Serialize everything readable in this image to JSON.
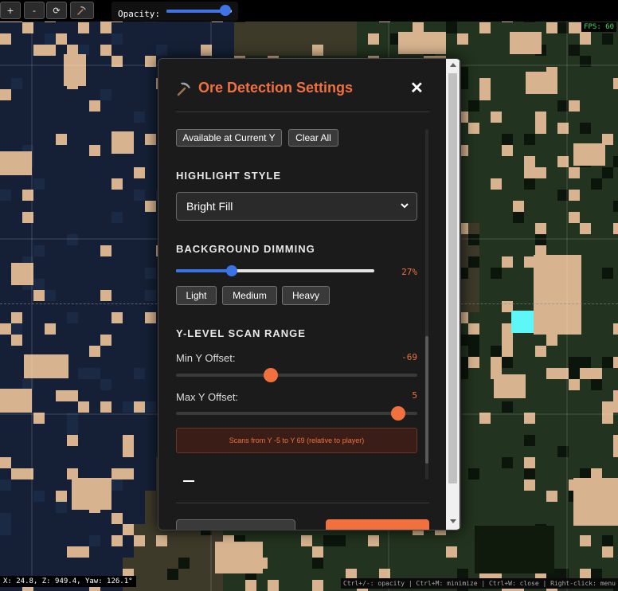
{
  "toolbar": {
    "buttons": [
      {
        "name": "zoom-in-button",
        "label": "+"
      },
      {
        "name": "zoom-out-button",
        "label": "-"
      },
      {
        "name": "refresh-button",
        "label": "⟳"
      }
    ],
    "pickaxe_icon": "pickaxe-icon",
    "opacity_label": "Opacity:",
    "opacity_value": 0.9
  },
  "fps": "FPS: 60",
  "coords": "X: 24.8, Z: 949.4, Yaw: 126.1°",
  "hints": "Ctrl+/-: opacity | Ctrl+M: minimize | Ctrl+W: close | Right-click: menu",
  "modal": {
    "title": "Ore Detection Settings",
    "title_icon": "pickaxe-icon",
    "close": "✕",
    "available_btn": "Available at Current Y",
    "clear_btn": "Clear All",
    "highlight": {
      "heading": "HIGHLIGHT STYLE",
      "selected": "Bright Fill"
    },
    "dimming": {
      "heading": "BACKGROUND DIMMING",
      "value_text": "27%",
      "value": 27,
      "presets": [
        "Light",
        "Medium",
        "Heavy"
      ]
    },
    "scan": {
      "heading": "Y-LEVEL SCAN RANGE",
      "min_label": "Min Y Offset:",
      "min_value": -69,
      "min_text": "-69",
      "max_label": "Max Y Offset:",
      "max_value": 5,
      "max_text": "5",
      "info": "Scans from Y -5  to Y 69  (relative to player)"
    }
  },
  "colors": {
    "accent": "#f07140",
    "slider_blue": "#3a73e6",
    "water": "#152036",
    "grass": "#22331f",
    "sand": "#d7b48f",
    "diamond": "#5ef7f7"
  }
}
